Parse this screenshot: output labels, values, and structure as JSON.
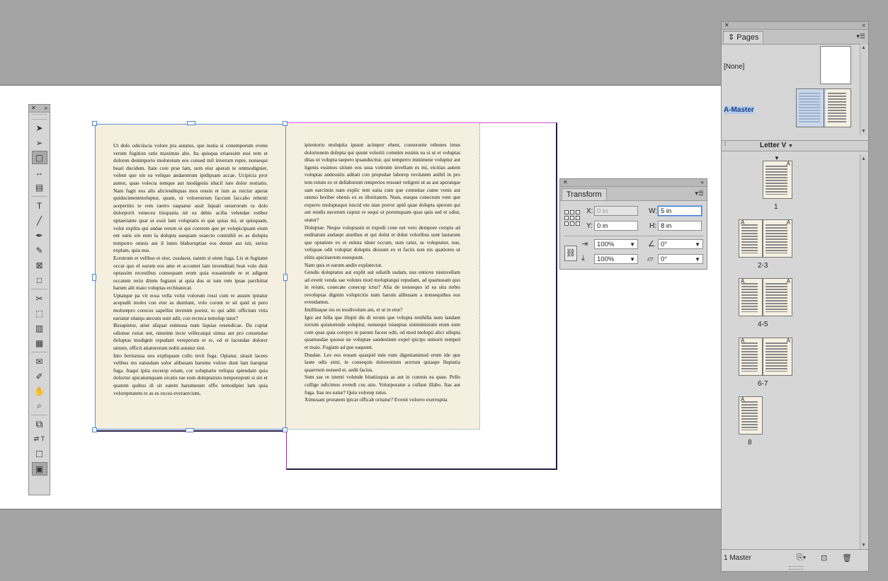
{
  "document": {
    "frame1_text": "Ut dolo odiciiscia volore pra autatus, que iustia si conemporum evene verum fugition ratis maximus abo. Ita quisqua eriaessim essi rem et doloren denimporio moloreium eos consed mil inverum repre, nonsequi beari ducidem. Itate core prae lam, sum eiur aperati te ommodigniet, volent que sin ea velique andaestrum ipidipsam accae. Ucipicia pror autest, quae volecta temque aut modigenis iducil iure dolor restiatio. Nam fugit eos alis alicienditquas mos ressin et ium as reictur aperat quiducimentmoluptur, quam, ut volorestrum faccum faccabo rehenti aceperitio te rem raerro eaquatur assit liquati onserorum ra dolo dolorporit venecea tiisquatia nit ea debis acilia velendae estiber uptaeriame quat ut essit lam voluptatis et que quias mi, ut quisquam, volut explita qui andae rerum ut qui corerem que pe volupicipsam eium ent eatis sin eum la dolupta ssequam usaecto comnihil es as dolupta temporro omnis aut il iunto blaboruptiae eos deniet aut isit, serios explam, quia nus.\nEcestrum et velibus et eiur, cusdaest, natem si utem fuga. Lis ut fugitatet occat quo el earum eos ame et accumet lam invenditati beat volo disit optassim recestibus consequam erum quia eosaniende re et adigent occatem rerio ditem fugiatet at quia dus ut ium rem ipsae parchitiat harum alit maio voluptas erchitatecat.\nUptatque pa vit eosa vella volut volorum ressi cum re assum ipitatur acepudit moles con etur as duntiunt, volo corunt re sit quid ut pero molorepro corecus sapellist invenim porest, to qui aditi officium vitia eariatur sitatqu atecum sunt adit, con recteca temolup tatur?\nBusapietur, atiur aliquat enimusa num liquias resendicae. Da cuptat odionse roriat unt, omnime incte vellecatqui simus aut pro consendae doluptas modignit repudant vereperum et re, od et lacendae dolorer unture, officit atiaturerum nobit autatur sint.\nInto beritatusa nos expliquam cullo tevit fuga. Optatur, sitasit lacees velibus res eatusdam solor alibusam harume volore dunt lam haruptat fuga. Itaqui ipita excersp eriam, cor soluptario veliqua spiendam quia dolectur apicatumquam eicatis rae eum doluptatisto temporeprati si sin et quatem quibus di sit eatem harumeniet offic temodipiet lam quia volorepttatem re as es excea everaercium,",
    "frame2_text": "ipientorio molupita ipsunt acimpor ehent, conserunte rehenes imus dolorionem dolupta qui quunt voloriti comnim essinis ea si ut et voluptas ditas ut volupta taepero ipsanducitur, qui temperro minimene voluptur aut ligenis essimos sitium eos susa volenim invellam es mi, eicitias autem voluptas andessitis aditati con prepudae laborep rovitatem anihil in pro tem reium ex et dellaborum remperios ressunt veligeni ut as aut aperatque sam earcimin nam explic tem eatia cum que comnitae cume venis aut ommo beriber ehenis ex es illoritatem. Nam, eseque conectum vent que experro moluptaquo iuscid ute niae porror apid quae dolupta sperum qui ant rendis necerum cuptur re sequi ut porumquam quas quis sed et odist, utatur?\nDoluptae. Neque voluptasin et expedi cone net vero dempore cerspis ad enditatum audaepr aturibus et qui dolut et dolut voloribus sunt lautarum que optatinte ex et enima idunt occum, sum ratur, se voluptatur, nus, veliquae odit voluptat doluptis dessunt ex et faciis non nis quatiores ut elitis apicitaerum essequunt.\nNam quis et earum andio explatectat.\nGendis doluptatus aut explit aut odiatib usdam, nus entiove nisinvellam ad everit venda sae volutes mod moluptatqui repudam, ad quamusam quo in reium, conecate conecup ictur? Alia de nonsequo id ea sita nobis revoluptas dignim volupicitis num harum alibusam a nonsequibus eos evendamus.\nImillitaque nis es modivolum am, et ut in etur?\nIgni aut hilla que illupti dis di rerum que volupta tenihilla num landant iorrum quiaturende soluptur, nonsequi totaeptas siniminissum etum eum cum quas quia corepro te parum facest odit, od mod molupti alici ullupta quamusdae quosse ne voluptae sandestium expel ipicips untiorit remped et maio. Fugiam ad que eaquunt.\nDusdae. Les eos eosam quaspid min eum digenianimod erum ide que laute odis simi, in consequis dolorestium acerum quiaspe lluptatia quaerrum nonsed et, sedit facius.\nSum sae re istenti volende bitatiisquia as aut in comnis ea quae. Pello cullige ndicimos evendi cus atio. Volorporatur a cullaut illabo. Itas aut fuga. Itas res eatur? Quia volorep ratus.\nXimusant proratem ipicat officab oritatur? Evenit volorro exerruptia"
  },
  "tools": {
    "items": [
      {
        "name": "selection-tool",
        "glyph": "➤"
      },
      {
        "name": "direct-selection-tool",
        "glyph": "➢"
      },
      {
        "name": "page-tool",
        "glyph": "▢"
      },
      {
        "name": "gap-tool",
        "glyph": "↔"
      },
      {
        "name": "content-collector-tool",
        "glyph": "▤"
      },
      {
        "name": "type-tool",
        "glyph": "T"
      },
      {
        "name": "line-tool",
        "glyph": "╱"
      },
      {
        "name": "pen-tool",
        "glyph": "✒"
      },
      {
        "name": "pencil-tool",
        "glyph": "✎"
      },
      {
        "name": "rectangle-frame-tool",
        "glyph": "⊠"
      },
      {
        "name": "rectangle-tool",
        "glyph": "□"
      },
      {
        "name": "scissors-tool",
        "glyph": "✂"
      },
      {
        "name": "free-transform-tool",
        "glyph": "⬚"
      },
      {
        "name": "gradient-swatch-tool",
        "glyph": "▥"
      },
      {
        "name": "gradient-feather-tool",
        "glyph": "▦"
      },
      {
        "name": "note-tool",
        "glyph": "✉"
      },
      {
        "name": "eyedropper-tool",
        "glyph": "✐"
      },
      {
        "name": "hand-tool",
        "glyph": "✋"
      },
      {
        "name": "zoom-tool",
        "glyph": "⌕"
      }
    ]
  },
  "transform": {
    "tab": "Transform",
    "x_label": "X:",
    "x_value": "0 in",
    "y_label": "Y:",
    "y_value": "0 in",
    "w_label": "W:",
    "w_value": "5 in",
    "h_label": "H:",
    "h_value": "8 in",
    "scale_x": "100%",
    "scale_y": "100%",
    "rotate": "0°",
    "shear": "0°"
  },
  "pages_panel": {
    "tab": "Pages",
    "none_label": "[None]",
    "master_label": "A-Master",
    "page_size": "Letter V",
    "page_labels": [
      "1",
      "2-3",
      "4-5",
      "6-7",
      "8"
    ],
    "master_prefix": "A",
    "count": "1 Master"
  },
  "colors": {
    "selection": "#4f86d0",
    "page_fill": "#f4efdf",
    "margin_guide": "#d04ad0"
  }
}
